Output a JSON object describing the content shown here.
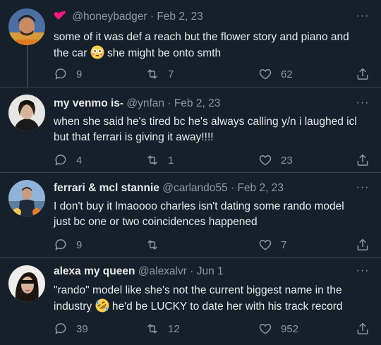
{
  "tweets": [
    {
      "name": "",
      "handle": "@honeybadger",
      "sep": "·",
      "date": "Feb 2, 23",
      "text_a": "some of it was def a reach but the flower story and piano and the car",
      "emoji": "flushed-face",
      "text_b": "she might be onto smth",
      "replies": "9",
      "retweets": "7",
      "likes": "62"
    },
    {
      "name": "my venmo is-",
      "handle": "@ynfan",
      "sep": "·",
      "date": "Feb 2, 23",
      "text_a": "when she said he's tired bc he's always calling y/n i laughed icl but that ferrari is giving it away!!!!",
      "replies": "4",
      "retweets": "1",
      "likes": "23"
    },
    {
      "name": "ferrari & mcl stannie",
      "handle": "@carlando55",
      "sep": "·",
      "date": "Feb 2, 23",
      "text_a": "I don't buy it lmaoooo charles isn't dating some rando model just bc one or two coincidences happened",
      "replies": "9",
      "retweets": "",
      "likes": "7"
    },
    {
      "name": "alexa my queen",
      "handle": "@alexalvr",
      "sep": "·",
      "date": "Jun 1",
      "text_a": "\"rando\" model like she's not the current biggest name in the industry",
      "emoji": "rolling-on-floor-laughing",
      "text_b": "he'd be LUCKY to date her with his track record",
      "replies": "39",
      "retweets": "12",
      "likes": "952"
    }
  ],
  "more_label": "···",
  "colors": {
    "background": "#15202b",
    "text": "#e7e9ea",
    "secondary": "#8b98a5",
    "border": "#38444d",
    "name_badge_heart": "#f91880"
  }
}
